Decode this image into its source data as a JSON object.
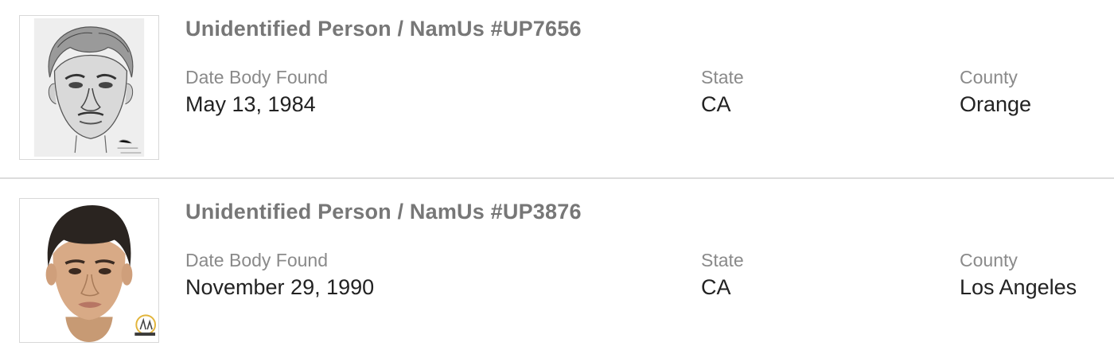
{
  "cases": [
    {
      "title": "Unidentified Person / NamUs #UP7656",
      "image_kind": "pencil-sketch",
      "date_label": "Date Body Found",
      "date_value": "May 13, 1984",
      "state_label": "State",
      "state_value": "CA",
      "county_label": "County",
      "county_value": "Orange"
    },
    {
      "title": "Unidentified Person / NamUs #UP3876",
      "image_kind": "color-reconstruction",
      "date_label": "Date Body Found",
      "date_value": "November 29, 1990",
      "state_label": "State",
      "state_value": "CA",
      "county_label": "County",
      "county_value": "Los Angeles"
    }
  ],
  "colors": {
    "title": "#777777",
    "label": "#8a8a8a",
    "value": "#222222",
    "divider": "#dcdcdc"
  }
}
